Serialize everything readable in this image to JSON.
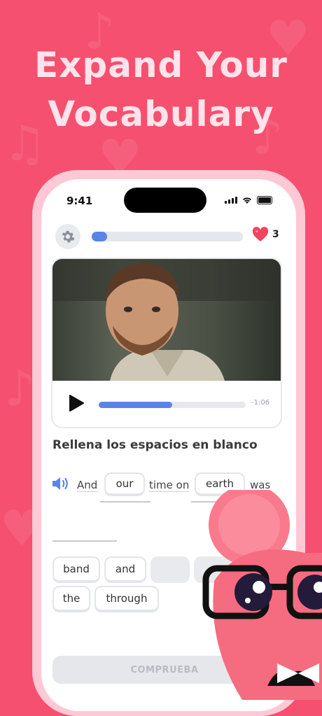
{
  "headline": {
    "line1": "Expand Your",
    "line2": "Vocabulary"
  },
  "status_bar": {
    "time": "9:41"
  },
  "lesson": {
    "progress": 0.1,
    "hearts": "3"
  },
  "video": {
    "time_remaining": "-1:06",
    "playback_progress": 0.5
  },
  "exercise": {
    "prompt": "Rellena los espacios en blanco",
    "sentence": {
      "w1": "And",
      "filled1": "our",
      "w2": "time on",
      "filled2": "earth",
      "w3": "was"
    },
    "word_bank": [
      "band",
      "and",
      "the",
      "through"
    ]
  },
  "buttons": {
    "check": "COMPRUEBA"
  },
  "colors": {
    "background": "#f5506f",
    "accent": "#5a84e6",
    "heart": "#f0445f"
  }
}
